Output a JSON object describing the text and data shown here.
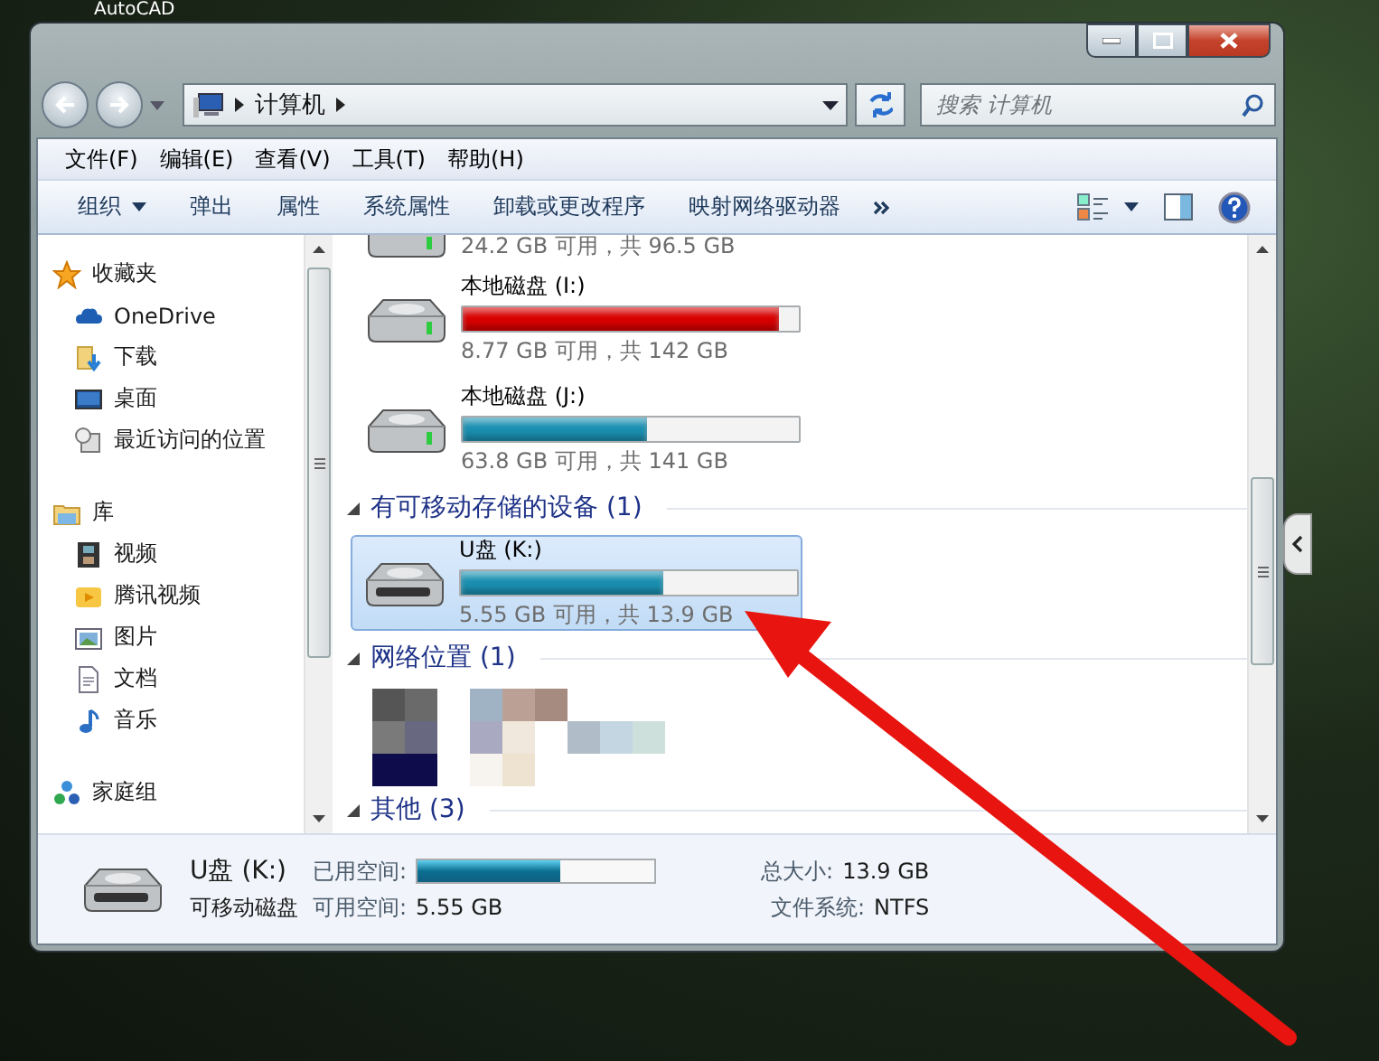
{
  "desktop_label": "AutoCAD",
  "address": {
    "crumbs": [
      "计算机"
    ],
    "search_placeholder": "搜索 计算机"
  },
  "menu": [
    "文件(F)",
    "编辑(E)",
    "查看(V)",
    "工具(T)",
    "帮助(H)"
  ],
  "toolbar": [
    {
      "label": "组织",
      "kind": "dropdown"
    },
    {
      "label": "弹出",
      "kind": "button"
    },
    {
      "label": "属性",
      "kind": "button"
    },
    {
      "label": "系统属性",
      "kind": "button"
    },
    {
      "label": "卸载或更改程序",
      "kind": "button"
    },
    {
      "label": "映射网络驱动器",
      "kind": "button"
    }
  ],
  "nav": [
    {
      "label": "收藏夹",
      "children": [
        {
          "label": "OneDrive"
        },
        {
          "label": "下载"
        },
        {
          "label": "桌面"
        },
        {
          "label": "最近访问的位置"
        }
      ]
    },
    {
      "label": "库",
      "children": [
        {
          "label": "视频"
        },
        {
          "label": "腾讯视频"
        },
        {
          "label": "图片"
        },
        {
          "label": "文档"
        },
        {
          "label": "音乐"
        }
      ]
    },
    {
      "label": "家庭组"
    }
  ],
  "drives": [
    {
      "free": "24.2 GB 可用，共 96.5 GB"
    },
    {
      "name": "本地磁盘 (I:)",
      "level": 0.94,
      "color": "#d80000",
      "free": "8.77 GB 可用，共 142 GB"
    },
    {
      "name": "本地磁盘 (J:)",
      "level": 0.55,
      "color": "#1a8fb0",
      "free": "63.8 GB 可用，共 141 GB"
    }
  ],
  "groups": [
    {
      "title": "有可移动存储的设备 (1)",
      "expanded": true,
      "items": [
        {
          "kind": "drive",
          "name": "U盘 (K:)",
          "level": 0.6,
          "color": "#1a8fb0",
          "free": "5.55 GB 可用，共 13.9 GB",
          "selected": true
        }
      ]
    },
    {
      "title": "网络位置 (1)",
      "expanded": true,
      "items": [
        {
          "kind": "obscured"
        }
      ]
    },
    {
      "title": "其他 (3)",
      "expanded": true
    }
  ],
  "details": {
    "name": "U盘 (K:)",
    "type": "可移动磁盘",
    "fields": [
      {
        "kind": "bar",
        "label": "已用空间:",
        "level": 0.6
      },
      {
        "kind": "text",
        "label": "可用空间:",
        "value": "5.55 GB"
      },
      {
        "kind": "text",
        "label": "总大小:",
        "value": "13.9 GB"
      },
      {
        "kind": "text",
        "label": "文件系统:",
        "value": "NTFS"
      }
    ]
  }
}
